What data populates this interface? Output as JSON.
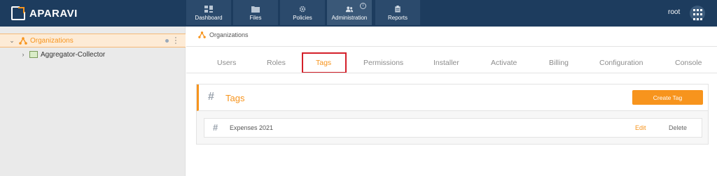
{
  "app": {
    "logo_text": "APARAVI"
  },
  "nav": [
    {
      "label": "Dashboard",
      "icon": "dashboard-icon"
    },
    {
      "label": "Files",
      "icon": "folder-icon"
    },
    {
      "label": "Policies",
      "icon": "gear-icon"
    },
    {
      "label": "Administration",
      "icon": "users-icon",
      "active": true
    },
    {
      "label": "Reports",
      "icon": "clipboard-icon"
    }
  ],
  "user": {
    "name": "root"
  },
  "sidebar": {
    "items": [
      {
        "label": "Organizations",
        "selected": true
      },
      {
        "label": "Aggregator-Collector"
      }
    ]
  },
  "breadcrumb": {
    "label": "Organizations"
  },
  "tabs": [
    {
      "label": "Users"
    },
    {
      "label": "Roles"
    },
    {
      "label": "Tags",
      "active": true
    },
    {
      "label": "Permissions"
    },
    {
      "label": "Installer"
    },
    {
      "label": "Activate"
    },
    {
      "label": "Billing"
    },
    {
      "label": "Configuration"
    },
    {
      "label": "Console"
    }
  ],
  "panel": {
    "title": "Tags",
    "create_label": "Create Tag",
    "rows": [
      {
        "name": "Expenses 2021",
        "edit_label": "Edit",
        "delete_label": "Delete"
      }
    ]
  },
  "colors": {
    "accent": "#f7941d",
    "topbar": "#1d3c5e",
    "highlight_box": "#d4202a"
  }
}
